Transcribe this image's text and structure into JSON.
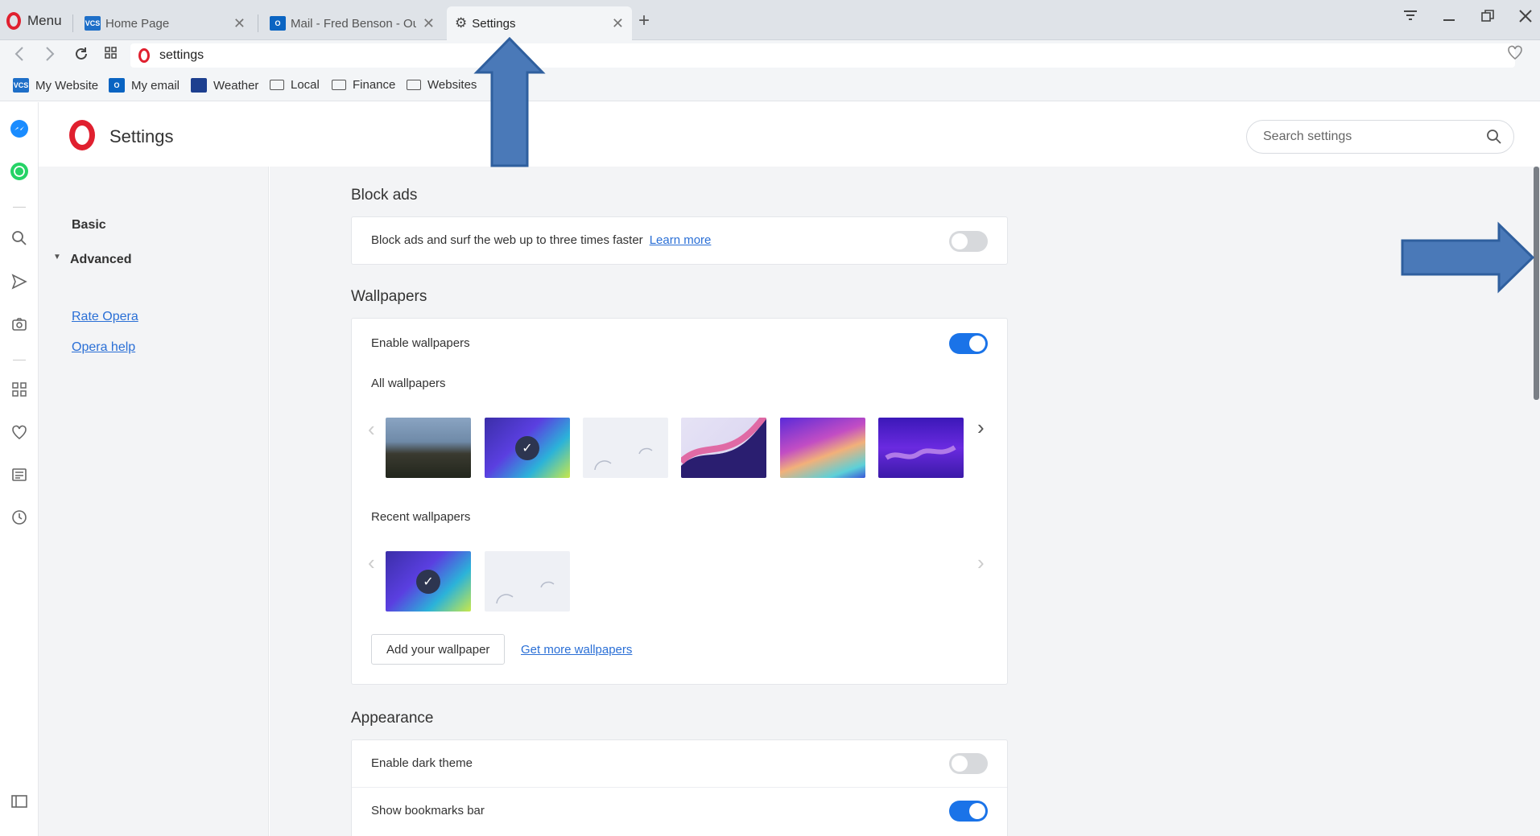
{
  "tabstrip": {
    "menu_label": "Menu",
    "tabs": [
      {
        "title": "Home Page",
        "favicon": "vcs-logo-icon"
      },
      {
        "title": "Mail - Fred Benson - Outl",
        "favicon": "outlook-icon"
      },
      {
        "title": "Settings",
        "favicon": "gear-icon"
      }
    ],
    "new_tab": "+"
  },
  "address": {
    "url": "settings"
  },
  "bookmarks": [
    {
      "label": "My Website",
      "icon": "vcs-logo-icon"
    },
    {
      "label": "My email",
      "icon": "outlook-icon"
    },
    {
      "label": "Weather",
      "icon": "weather-icon"
    },
    {
      "label": "Local",
      "icon": "folder-icon"
    },
    {
      "label": "Finance",
      "icon": "folder-icon"
    },
    {
      "label": "Websites",
      "icon": "folder-icon"
    }
  ],
  "header": {
    "title": "Settings",
    "search_placeholder": "Search settings"
  },
  "nav": {
    "basic": "Basic",
    "advanced": "Advanced",
    "rate": "Rate Opera",
    "help": "Opera help"
  },
  "block_ads": {
    "title": "Block ads",
    "description": "Block ads and surf the web up to three times faster",
    "learn_more": "Learn more",
    "enabled": false
  },
  "wallpapers": {
    "title": "Wallpapers",
    "enable_label": "Enable wallpapers",
    "enabled": true,
    "all_label": "All wallpapers",
    "recent_label": "Recent wallpapers",
    "add_button": "Add your wallpaper",
    "get_more": "Get more wallpapers"
  },
  "appearance": {
    "title": "Appearance",
    "dark_theme_label": "Enable dark theme",
    "dark_theme_enabled": false,
    "bookmarks_bar_label": "Show bookmarks bar",
    "bookmarks_bar_enabled": true
  },
  "colors": {
    "accent": "#1a73e8",
    "opera_red": "#e0202f",
    "annotation_arrow": "#4a79b8"
  }
}
